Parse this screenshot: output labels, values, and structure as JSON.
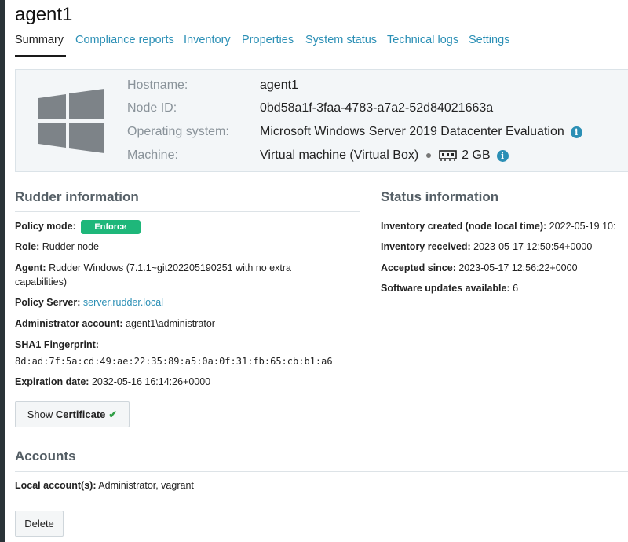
{
  "page": {
    "title": "agent1"
  },
  "tabs": [
    {
      "label": "Summary",
      "active": true
    },
    {
      "label": "Compliance reports"
    },
    {
      "label": "Inventory"
    },
    {
      "label": "Properties"
    },
    {
      "label": "System status"
    },
    {
      "label": "Technical logs"
    },
    {
      "label": "Settings"
    }
  ],
  "summary": {
    "os_icon": "windows-logo-icon",
    "rows": [
      {
        "label": "Hostname:",
        "value": "agent1"
      },
      {
        "label": "Node ID:",
        "value": "0bd58a1f-3faa-4783-a7a2-52d84021663a"
      },
      {
        "label": "Operating system:",
        "value": "Microsoft Windows Server 2019 Datacenter Evaluation"
      },
      {
        "label": "Machine:",
        "value": "Virtual machine (Virtual Box)",
        "ram": "2 GB"
      }
    ]
  },
  "rudder_info": {
    "title": "Rudder information",
    "policy_mode_label": "Policy mode:",
    "policy_mode_value": "Enforce",
    "role_label": "Role:",
    "role_value": "Rudder node",
    "agent_label": "Agent:",
    "agent_value_line1": "Rudder Windows (7.1.1~git202205190251 with no extra",
    "agent_value_line2": "capabilities)",
    "policy_server_label": "Policy Server:",
    "policy_server_value": "server.rudder.local",
    "admin_label": "Administrator account:",
    "admin_value": "agent1\\administrator",
    "sha1_label": "SHA1 Fingerprint:",
    "sha1_value": "8d:ad:7f:5a:cd:49:ae:22:35:89:a5:0a:0f:31:fb:65:cb:b1:a6",
    "expiration_label": "Expiration date:",
    "expiration_value": "2032-05-16 16:14:26+0000",
    "show_cert_prefix": "Show ",
    "show_cert_bold": "Certificate"
  },
  "status_info": {
    "title": "Status information",
    "rows": [
      {
        "label": "Inventory created (node local time):",
        "value": "2022-05-19 10:"
      },
      {
        "label": "Inventory received:",
        "value": "2023-05-17 12:50:54+0000"
      },
      {
        "label": "Accepted since:",
        "value": "2023-05-17 12:56:22+0000"
      },
      {
        "label": "Software updates available:",
        "value": "6"
      }
    ]
  },
  "accounts": {
    "title": "Accounts",
    "local_label": "Local account(s):",
    "local_value": "Administrator, vagrant"
  },
  "actions": {
    "delete_label": "Delete"
  },
  "colors": {
    "accent": "#2b8fb5",
    "enforce_badge": "#1eb77a"
  }
}
